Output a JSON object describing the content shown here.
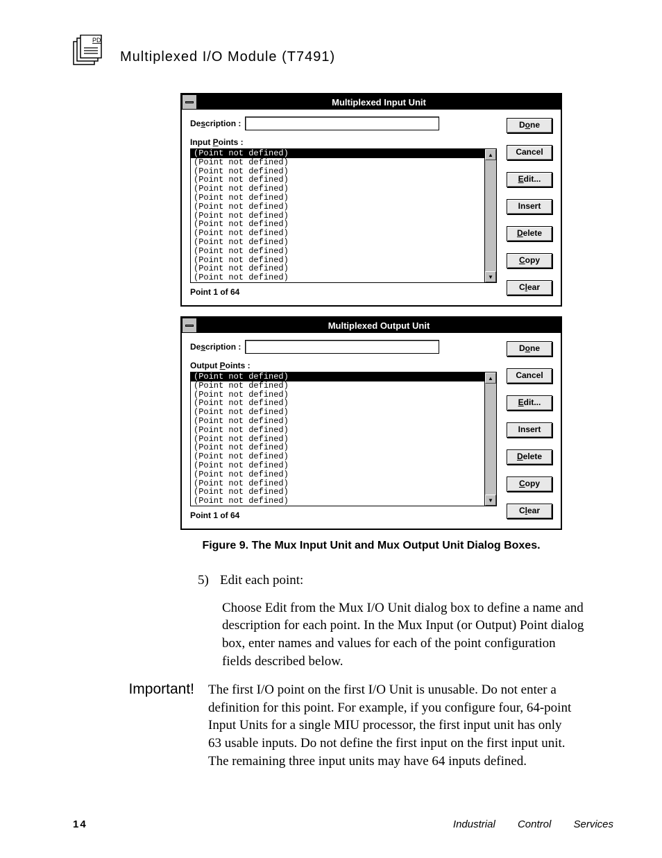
{
  "header": {
    "title": "Multiplexed  I/O  Module  (T7491)",
    "icon_label": "PD"
  },
  "dialog_input": {
    "title": "Multiplexed Input Unit",
    "desc_label_pre": "De",
    "desc_label_u": "s",
    "desc_label_post": "cription :",
    "desc_value": "",
    "points_label_pre": "Input ",
    "points_label_u": "P",
    "points_label_post": "oints :",
    "items": [
      "(Point not defined)",
      "(Point not defined)",
      "(Point not defined)",
      "(Point not defined)",
      "(Point not defined)",
      "(Point not defined)",
      "(Point not defined)",
      "(Point not defined)",
      "(Point not defined)",
      "(Point not defined)",
      "(Point not defined)",
      "(Point not defined)",
      "(Point not defined)",
      "(Point not defined)",
      "(Point not defined)"
    ],
    "status": "Point 1  of 64",
    "buttons": {
      "done_pre": "D",
      "done_u": "o",
      "done_post": "ne",
      "cancel": "Cancel",
      "edit_u": "E",
      "edit_post": "dit...",
      "insert": "Insert",
      "delete_u": "D",
      "delete_post": "elete",
      "copy_u": "C",
      "copy_post": "opy",
      "clear_pre": "C",
      "clear_u": "l",
      "clear_post": "ear"
    }
  },
  "dialog_output": {
    "title": "Multiplexed Output Unit",
    "desc_label_pre": "De",
    "desc_label_u": "s",
    "desc_label_post": "cription :",
    "desc_value": "",
    "points_label_pre": "Output ",
    "points_label_u": "P",
    "points_label_post": "oints :",
    "items": [
      "(Point not defined)",
      "(Point not defined)",
      "(Point not defined)",
      "(Point not defined)",
      "(Point not defined)",
      "(Point not defined)",
      "(Point not defined)",
      "(Point not defined)",
      "(Point not defined)",
      "(Point not defined)",
      "(Point not defined)",
      "(Point not defined)",
      "(Point not defined)",
      "(Point not defined)",
      "(Point not defined)"
    ],
    "status": "Point 1  of 64",
    "buttons": {
      "done_pre": "D",
      "done_u": "o",
      "done_post": "ne",
      "cancel": "Cancel",
      "edit_u": "E",
      "edit_post": "dit...",
      "insert": "Insert",
      "delete_u": "D",
      "delete_post": "elete",
      "copy_u": "C",
      "copy_post": "opy",
      "clear_pre": "C",
      "clear_u": "l",
      "clear_post": "ear"
    }
  },
  "figure_caption": "Figure 9.  The Mux Input Unit and Mux Output Unit Dialog Boxes.",
  "step": {
    "num": "5)",
    "title": "Edit each point:"
  },
  "para1": "Choose Edit from the Mux I/O Unit dialog box to define a name and description for each point.  In the Mux Input (or Output) Point dialog box, enter names and values for each of the point configuration fields described below.",
  "important_label": "Important!",
  "important_text": "The first I/O point on the first I/O Unit is unusable.  Do not enter a definition for this point.  For example, if you configure four, 64-point Input Units for a single MIU processor, the first input unit has only 63 usable inputs.  Do not define the first input on the first input unit.  The remaining three input units may have 64 inputs defined.",
  "footer": {
    "page": "14",
    "right": "Industrial Control Services"
  }
}
